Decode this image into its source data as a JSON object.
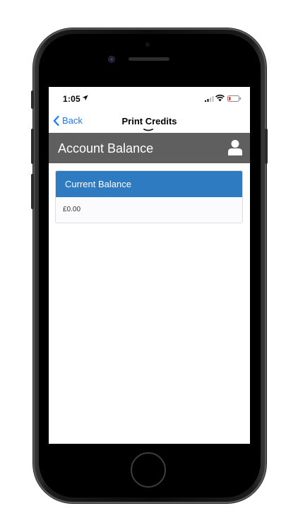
{
  "status_bar": {
    "time": "1:05"
  },
  "nav": {
    "back_label": "Back",
    "title": "Print Credits"
  },
  "header": {
    "title": "Account Balance"
  },
  "balance_card": {
    "heading": "Current Balance",
    "amount": "£0.00"
  },
  "colors": {
    "header_bg": "#5f5f5f",
    "card_header_bg": "#2f7bc2",
    "link": "#1a7cf5",
    "battery_low": "#e53935"
  },
  "icons": [
    "location-arrow-icon",
    "signal-icon",
    "wifi-icon",
    "battery-icon",
    "chevron-left-icon",
    "user-icon"
  ]
}
